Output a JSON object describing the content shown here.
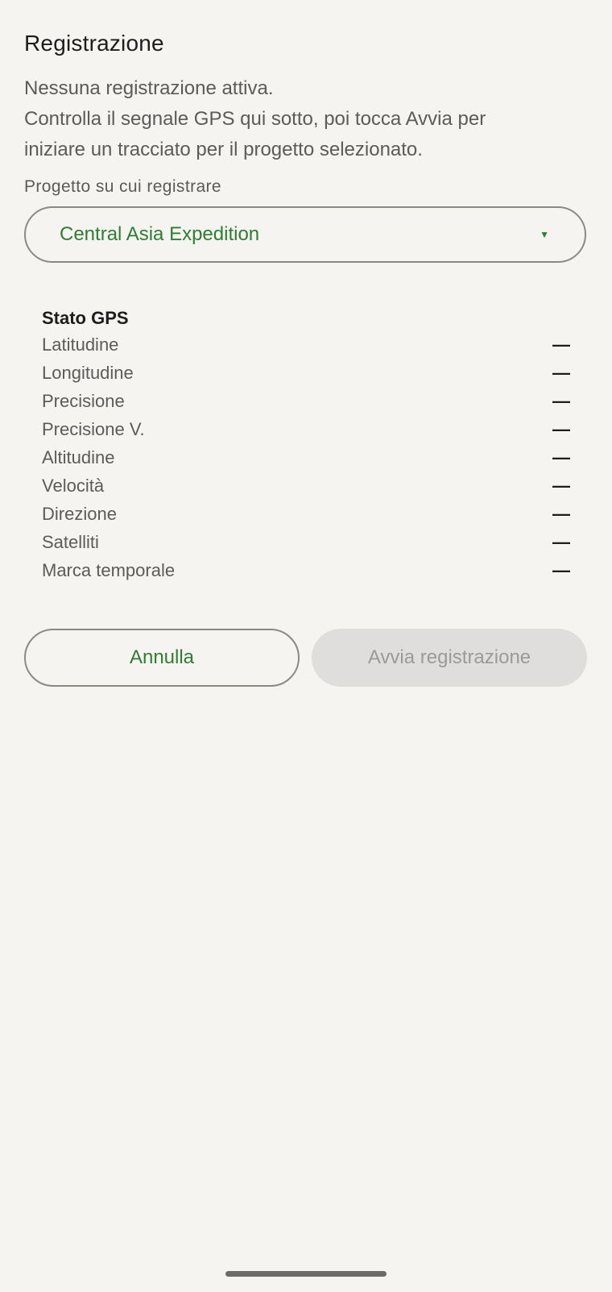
{
  "screen": {
    "title": "Registrazione",
    "description_lines": [
      "Nessuna registrazione attiva.",
      "Controlla il segnale GPS qui sotto, poi tocca Avvia per",
      "iniziare un tracciato per il progetto selezionato."
    ]
  },
  "project": {
    "label": "Progetto su cui registrare",
    "selected": "Central Asia Expedition",
    "dropdown_icon": "caret-down-icon",
    "accent_color": "#2e7d32"
  },
  "gps": {
    "title": "Stato GPS",
    "rows": [
      {
        "label": "Latitudine",
        "value": "—"
      },
      {
        "label": "Longitudine",
        "value": "—"
      },
      {
        "label": "Precisione",
        "value": "—"
      },
      {
        "label": "Precisione V.",
        "value": "—"
      },
      {
        "label": "Altitudine",
        "value": "—"
      },
      {
        "label": "Velocità",
        "value": "—"
      },
      {
        "label": "Direzione",
        "value": "—"
      },
      {
        "label": "Satelliti",
        "value": "—"
      },
      {
        "label": "Marca temporale",
        "value": "—"
      }
    ]
  },
  "actions": {
    "cancel_label": "Annulla",
    "start_label": "Avvia registrazione"
  }
}
